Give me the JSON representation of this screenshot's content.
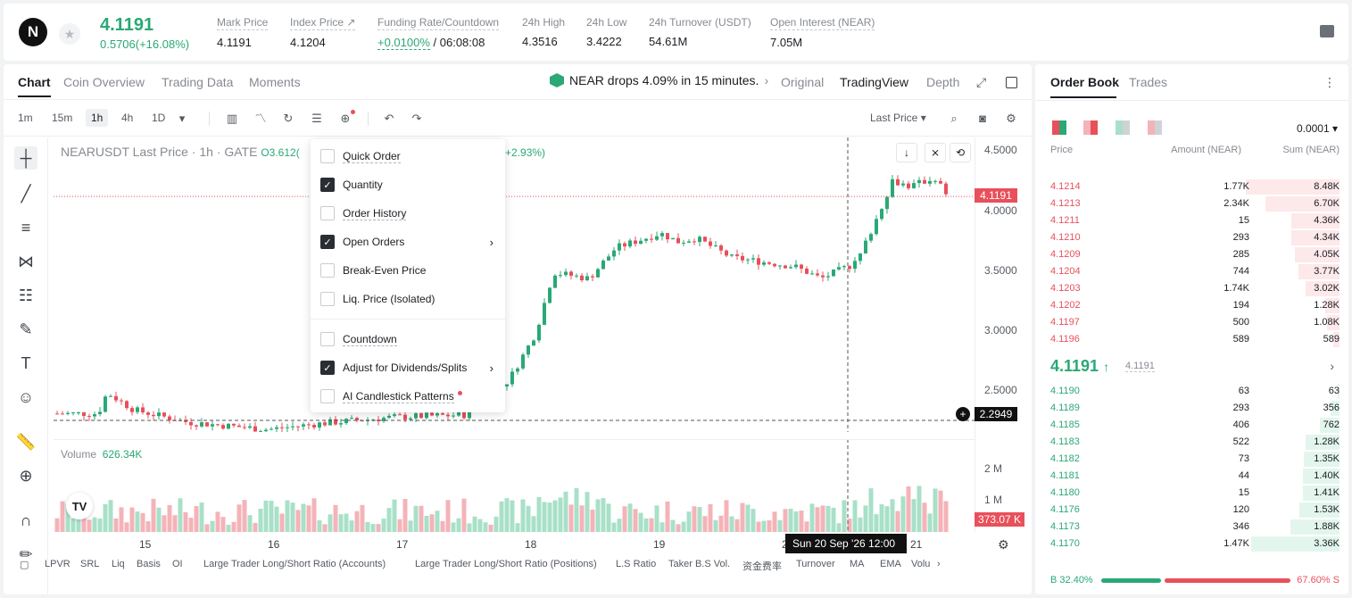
{
  "header": {
    "logo": "N",
    "last_price": "4.1191",
    "change": "0.5706(+16.08%)",
    "stats": [
      {
        "label": "Mark Price",
        "value": "4.1191"
      },
      {
        "label": "Index Price ↗",
        "value": "4.1204"
      },
      {
        "label": "Funding Rate/Countdown",
        "value_green": "+0.0100%",
        "value": " / 06:08:08"
      },
      {
        "label": "24h High",
        "value": "4.3516"
      },
      {
        "label": "24h Low",
        "value": "3.4222"
      },
      {
        "label": "24h Turnover (USDT)",
        "value": "54.61M"
      },
      {
        "label": "Open Interest (NEAR)",
        "value": "7.05M"
      }
    ]
  },
  "chart_tabs": [
    "Chart",
    "Coin Overview",
    "Trading Data",
    "Moments"
  ],
  "news": "NEAR drops 4.09% in 15 minutes.",
  "view_tabs": [
    "Original",
    "TradingView",
    "Depth"
  ],
  "timeframes": [
    "1m",
    "15m",
    "1h",
    "4h",
    "1D"
  ],
  "price_source": "Last Price",
  "chart_title": "NEARUSDT Last Price · 1h · GATE",
  "chart_o": "O3.612(",
  "chart_chg": "+2.93%)",
  "dropdown": {
    "items": [
      {
        "label": "Quick Order",
        "checked": false
      },
      {
        "label": "Quantity",
        "checked": true
      },
      {
        "label": "Order History",
        "checked": false
      },
      {
        "label": "Open Orders",
        "checked": true
      },
      {
        "label": "Break-Even Price",
        "checked": false
      },
      {
        "label": "Liq. Price (Isolated)",
        "checked": false
      },
      {
        "label": "Countdown",
        "checked": false
      },
      {
        "label": "Adjust for Dividends/Splits",
        "checked": true
      },
      {
        "label": "AI Candlestick Patterns",
        "checked": false
      }
    ]
  },
  "y_ticks": [
    "4.5000",
    "4.0000",
    "3.5000",
    "3.0000",
    "2.5000"
  ],
  "last_tag": "4.1191",
  "cross_tag": "2.2949",
  "vol_label": "Volume",
  "vol_value": "626.34K",
  "vol_ticks": [
    "2 M",
    "1 M"
  ],
  "vol_tag": "373.07 K",
  "x_ticks": [
    "15",
    "16",
    "17",
    "18",
    "19",
    "20",
    "21"
  ],
  "crosshair_date": "Sun 20 Sep '26   12:00",
  "indicators": [
    "LPVR",
    "SRL",
    "Liq",
    "Basis",
    "OI",
    "Large Trader Long/Short Ratio (Accounts)",
    "Large Trader Long/Short Ratio (Positions)",
    "L.S Ratio",
    "Taker B.S Vol.",
    "资金费率",
    "Turnover",
    "MA",
    "EMA",
    "Volu"
  ],
  "orderbook": {
    "tabs": [
      "Order Book",
      "Trades"
    ],
    "precision": "0.0001",
    "headers": [
      "Price",
      "Amount (NEAR)",
      "Sum (NEAR)"
    ],
    "asks": [
      {
        "p": "4.1214",
        "a": "1.77K",
        "s": "8.48K",
        "d": 1.0
      },
      {
        "p": "4.1213",
        "a": "2.34K",
        "s": "6.70K",
        "d": 0.79
      },
      {
        "p": "4.1211",
        "a": "15",
        "s": "4.36K",
        "d": 0.51
      },
      {
        "p": "4.1210",
        "a": "293",
        "s": "4.34K",
        "d": 0.51
      },
      {
        "p": "4.1209",
        "a": "285",
        "s": "4.05K",
        "d": 0.48
      },
      {
        "p": "4.1204",
        "a": "744",
        "s": "3.77K",
        "d": 0.44
      },
      {
        "p": "4.1203",
        "a": "1.74K",
        "s": "3.02K",
        "d": 0.36
      },
      {
        "p": "4.1202",
        "a": "194",
        "s": "1.28K",
        "d": 0.15
      },
      {
        "p": "4.1197",
        "a": "500",
        "s": "1.08K",
        "d": 0.13
      },
      {
        "p": "4.1196",
        "a": "589",
        "s": "589",
        "d": 0.07
      }
    ],
    "mid": "4.1191",
    "mid_sub": "4.1191",
    "bids": [
      {
        "p": "4.1190",
        "a": "63",
        "s": "63",
        "d": 0.02
      },
      {
        "p": "4.1189",
        "a": "293",
        "s": "356",
        "d": 0.1
      },
      {
        "p": "4.1185",
        "a": "406",
        "s": "762",
        "d": 0.21
      },
      {
        "p": "4.1183",
        "a": "522",
        "s": "1.28K",
        "d": 0.36
      },
      {
        "p": "4.1182",
        "a": "73",
        "s": "1.35K",
        "d": 0.38
      },
      {
        "p": "4.1181",
        "a": "44",
        "s": "1.40K",
        "d": 0.39
      },
      {
        "p": "4.1180",
        "a": "15",
        "s": "1.41K",
        "d": 0.39
      },
      {
        "p": "4.1176",
        "a": "120",
        "s": "1.53K",
        "d": 0.43
      },
      {
        "p": "4.1173",
        "a": "346",
        "s": "1.88K",
        "d": 0.52
      },
      {
        "p": "4.1170",
        "a": "1.47K",
        "s": "3.36K",
        "d": 0.94
      }
    ],
    "buy_ratio": "32.40%",
    "sell_ratio": "67.60%",
    "buy_label": "B",
    "sell_label": "S"
  },
  "colors": {
    "up": "#2aa876",
    "down": "#e8505b"
  }
}
